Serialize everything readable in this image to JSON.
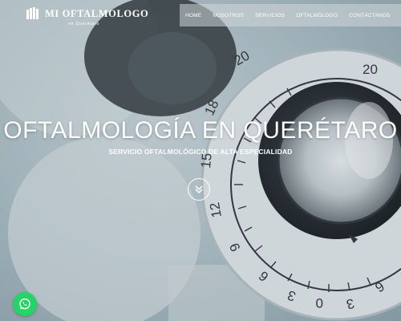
{
  "logo": {
    "name": "MI OFTALMOLOGO",
    "tagline": "en Querétaro"
  },
  "nav": {
    "items": [
      {
        "label": "HOME"
      },
      {
        "label": "NOSOTROS"
      },
      {
        "label": "SERVICIOS"
      },
      {
        "label": "OFTALMÓLOGO"
      },
      {
        "label": "CONTÁCTANOS"
      }
    ]
  },
  "hero": {
    "title": "OFTALMOLOGÍA EN QUERÉTARO",
    "subtitle": "SERVICIO OFTALMOLÓGICO DE ALTA ESPECIALIDAD"
  },
  "icons": {
    "scroll": "chevrons-down-icon",
    "whatsapp": "whatsapp-icon",
    "logo": "logo-icon"
  },
  "colors": {
    "whatsapp": "#25d366",
    "text": "#ffffff"
  }
}
